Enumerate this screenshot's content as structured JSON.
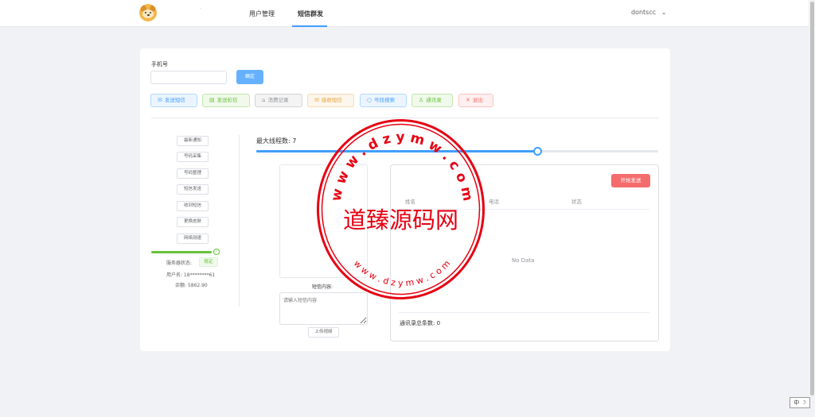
{
  "nav": {
    "logo_icon": "shiba-dog-icon",
    "logo_mark": "·",
    "items": [
      {
        "label": "用户管理",
        "active": false
      },
      {
        "label": "短信群发",
        "active": true
      }
    ],
    "user": "dontscc",
    "user_caret": "⌄"
  },
  "form": {
    "phone_label": "手机号",
    "phone_value": "",
    "confirm_button": "确定"
  },
  "actions": [
    {
      "label": "发送短信",
      "icon": "mail-icon",
      "glyph": "✉",
      "color": "#409eff"
    },
    {
      "label": "发送彩信",
      "icon": "inbox-icon",
      "glyph": "▤",
      "color": "#67c23a"
    },
    {
      "label": "消费记录",
      "icon": "lock-icon",
      "glyph": "⌂",
      "color": "#909399"
    },
    {
      "label": "接收短信",
      "icon": "mail-icon",
      "glyph": "✉",
      "color": "#e6a23c"
    },
    {
      "label": "号段搜索",
      "icon": "search-icon",
      "glyph": "○",
      "color": "#409eff"
    },
    {
      "label": "通讯录",
      "icon": "user-icon",
      "glyph": "♙",
      "color": "#67c23a"
    },
    {
      "label": "退出",
      "icon": "close-icon",
      "glyph": "✕",
      "color": "#f56c6c"
    }
  ],
  "sidebar": {
    "items": [
      "最新通知",
      "号码采集",
      "号码整理",
      "短信发送",
      "收到短信",
      "更换皮肤",
      "网络测速"
    ],
    "server_status_label": "服务器状态:",
    "server_status_value": "稳定",
    "progress": 1.0,
    "username_line": "用户名: 18********61",
    "balance_line": "余额: 5862.90"
  },
  "sender": {
    "thread_label": "最大线程数: 7",
    "thread_value": 7,
    "thread_slider_fraction": 0.7,
    "sms_content_label": "短信内容:",
    "sms_placeholder": "请输入短信内容",
    "upload_button": "上传视频"
  },
  "contacts": {
    "start_button": "开始发送",
    "columns": [
      "姓名",
      "电话",
      "状态"
    ],
    "empty_text": "No Data",
    "total_label": "通讯录总条数: 0"
  },
  "watermark": {
    "main_text": "道臻源码网",
    "ring_text_top": "w w w . d z y m w . c o m",
    "ring_text_bottom": "w w w . d z y m w . c o m",
    "color": "#e60012"
  },
  "ime_indicator": "中 ☽"
}
